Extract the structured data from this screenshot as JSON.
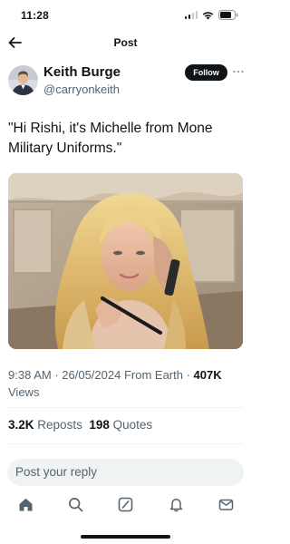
{
  "status_bar": {
    "time": "11:28",
    "icons": [
      "cellular-signal-icon",
      "wifi-icon",
      "battery-icon"
    ]
  },
  "header": {
    "title": "Post",
    "back_icon": "back-arrow-icon"
  },
  "post": {
    "author": {
      "name": "Keith Burge",
      "handle": "@carryonkeith",
      "avatar": "avatar-photo"
    },
    "follow_label": "Follow",
    "more_icon": "more-options-icon",
    "text": "\"Hi Rishi, it's Michelle from Mone Military Uniforms.\"",
    "media": "photo of woman with blonde hair on phone holding a pen",
    "meta": {
      "time": "9:38 AM",
      "separator": " · ",
      "date": "26/05/2024",
      "source": " From Earth",
      "views_count": "407K",
      "views_label": "Views"
    },
    "stats": {
      "reposts_count": "3.2K",
      "reposts_label": "Reposts",
      "quotes_count": "198",
      "quotes_label": "Quotes"
    }
  },
  "reply": {
    "placeholder": "Post your reply"
  },
  "tab_bar": {
    "items": [
      "home-icon",
      "search-icon",
      "grok-icon",
      "notifications-icon",
      "messages-icon"
    ]
  },
  "colors": {
    "text": "#0f1419",
    "secondary": "#536471",
    "follow_bg": "#0f1419",
    "reply_bg": "#eff3f4"
  }
}
